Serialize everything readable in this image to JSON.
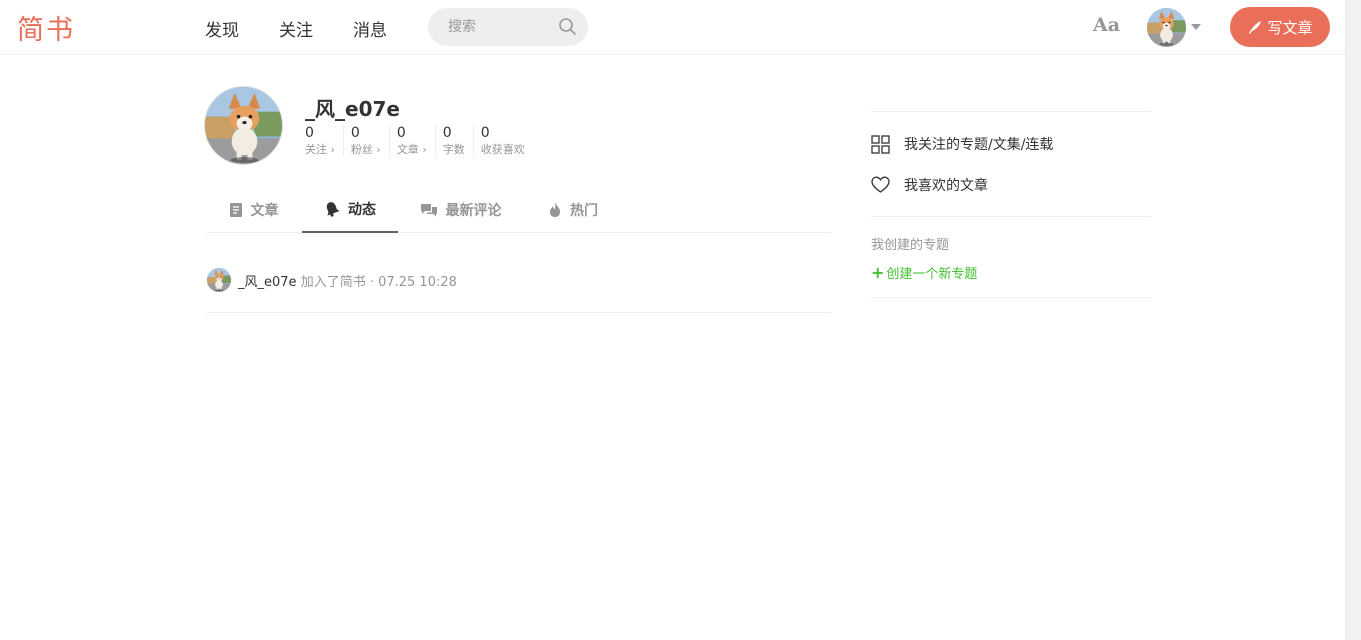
{
  "header": {
    "logo": "简书",
    "nav": [
      "发现",
      "关注",
      "消息"
    ],
    "search_placeholder": "搜索",
    "font_button": "Aa",
    "write_button": "写文章",
    "accent_color": "#ea6f5a"
  },
  "profile": {
    "name": "_风_e07e",
    "stats": [
      {
        "value": "0",
        "label": "关注 ›"
      },
      {
        "value": "0",
        "label": "粉丝 ›"
      },
      {
        "value": "0",
        "label": "文章 ›"
      },
      {
        "value": "0",
        "label": "字数"
      },
      {
        "value": "0",
        "label": "收获喜欢"
      }
    ]
  },
  "tabs": [
    {
      "label": "文章",
      "icon": "document-icon",
      "active": false
    },
    {
      "label": "动态",
      "icon": "bell-icon",
      "active": true
    },
    {
      "label": "最新评论",
      "icon": "comment-icon",
      "active": false
    },
    {
      "label": "热门",
      "icon": "fire-icon",
      "active": false
    }
  ],
  "feed": [
    {
      "user": "_风_e07e",
      "action": "加入了简书 · 07.25 10:28"
    }
  ],
  "sidebar": {
    "links": [
      {
        "label": "我关注的专题/文集/连载",
        "icon": "grid-icon"
      },
      {
        "label": "我喜欢的文章",
        "icon": "heart-icon"
      }
    ],
    "created_title": "我创建的专题",
    "create_label": "创建一个新专题",
    "create_color": "#42c02e"
  }
}
